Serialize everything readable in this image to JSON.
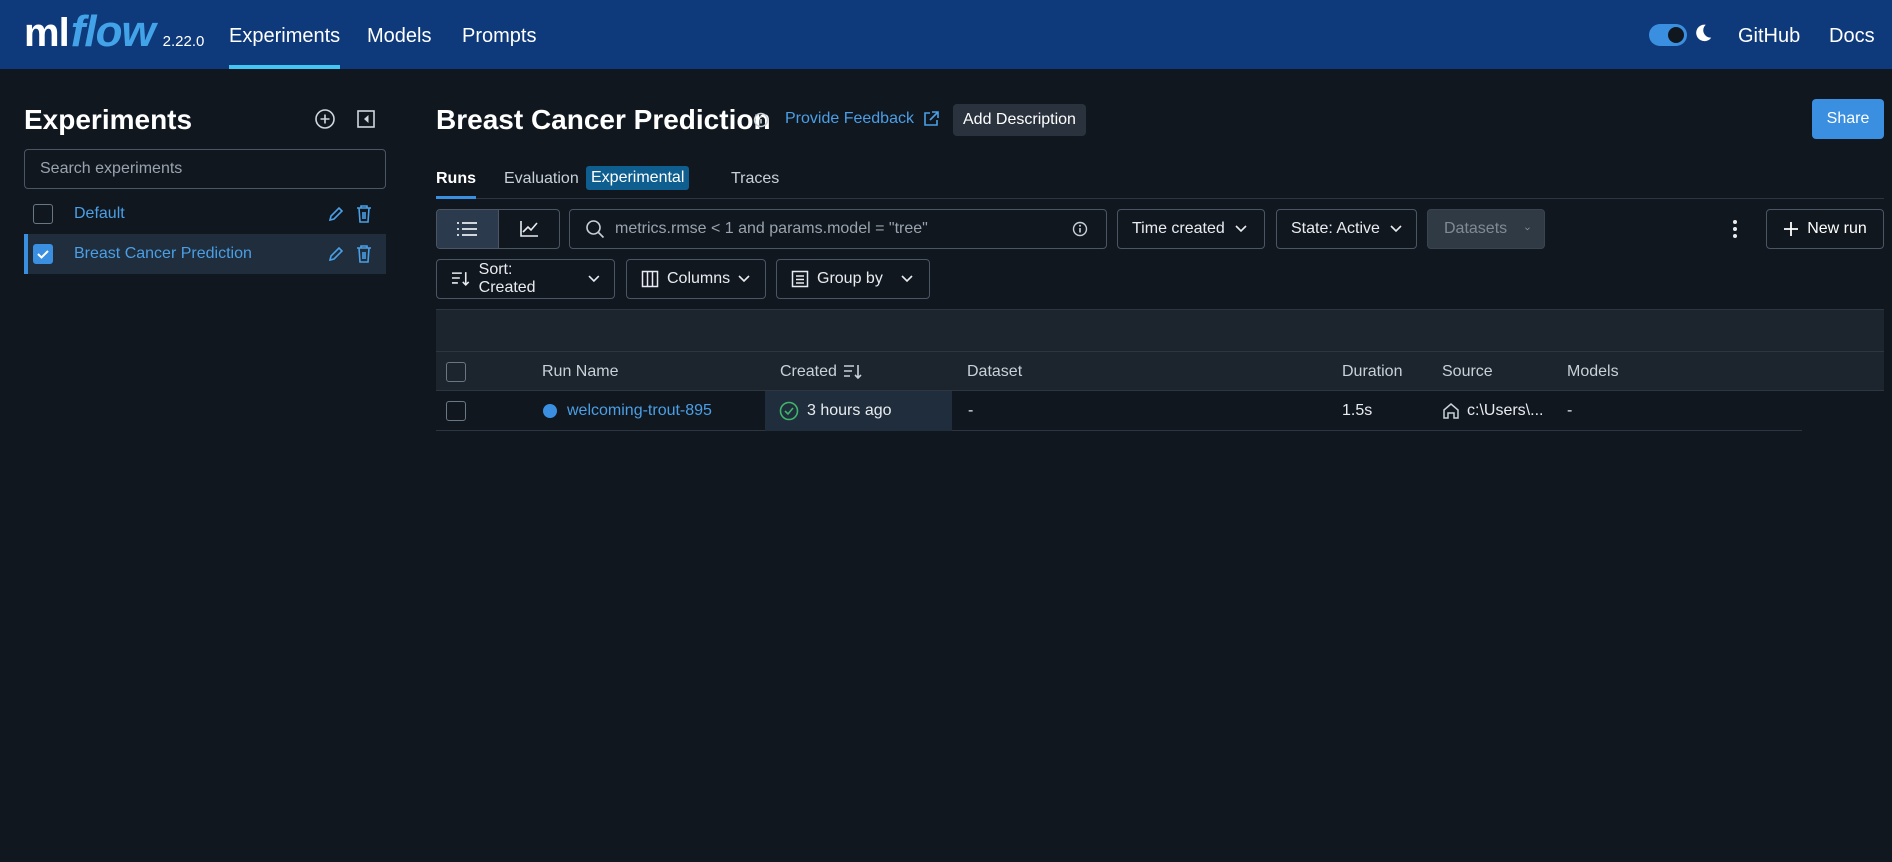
{
  "header": {
    "logo_ml": "ml",
    "logo_flow": "flow",
    "version": "2.22.0",
    "nav": [
      {
        "label": "Experiments",
        "active": true
      },
      {
        "label": "Models",
        "active": false
      },
      {
        "label": "Prompts",
        "active": false
      }
    ],
    "theme_dark": true,
    "github_label": "GitHub",
    "docs_label": "Docs"
  },
  "sidebar": {
    "title": "Experiments",
    "search_placeholder": "Search experiments",
    "experiments": [
      {
        "name": "Default",
        "checked": false,
        "selected": false
      },
      {
        "name": "Breast Cancer Prediction",
        "checked": true,
        "selected": true
      }
    ]
  },
  "main": {
    "title": "Breast Cancer Prediction",
    "feedback_label": "Provide Feedback",
    "add_description_label": "Add Description",
    "share_label": "Share",
    "tabs": {
      "runs": "Runs",
      "evaluation": "Evaluation",
      "experimental_tag": "Experimental",
      "traces": "Traces"
    },
    "toolbar": {
      "search_placeholder": "metrics.rmse < 1 and params.model = \"tree\"",
      "time_created": "Time created",
      "state": "State: Active",
      "datasets": "Datasets",
      "new_run": "New run",
      "sort": "Sort: Created",
      "columns": "Columns",
      "group_by": "Group by"
    },
    "table": {
      "columns": {
        "run_name": "Run Name",
        "created": "Created",
        "dataset": "Dataset",
        "duration": "Duration",
        "source": "Source",
        "models": "Models"
      },
      "rows": [
        {
          "run_name": "welcoming-trout-895",
          "run_color": "#3b8fe0",
          "created": "3 hours ago",
          "status": "finished",
          "dataset": "-",
          "duration": "1.5s",
          "source": "c:\\Users\\...",
          "models": "-"
        }
      ]
    }
  },
  "colors": {
    "header_bg": "#0e3a7b",
    "page_bg": "#11171f",
    "accent": "#3b8fe0",
    "link": "#4a9fe6",
    "success": "#3fb56a"
  }
}
